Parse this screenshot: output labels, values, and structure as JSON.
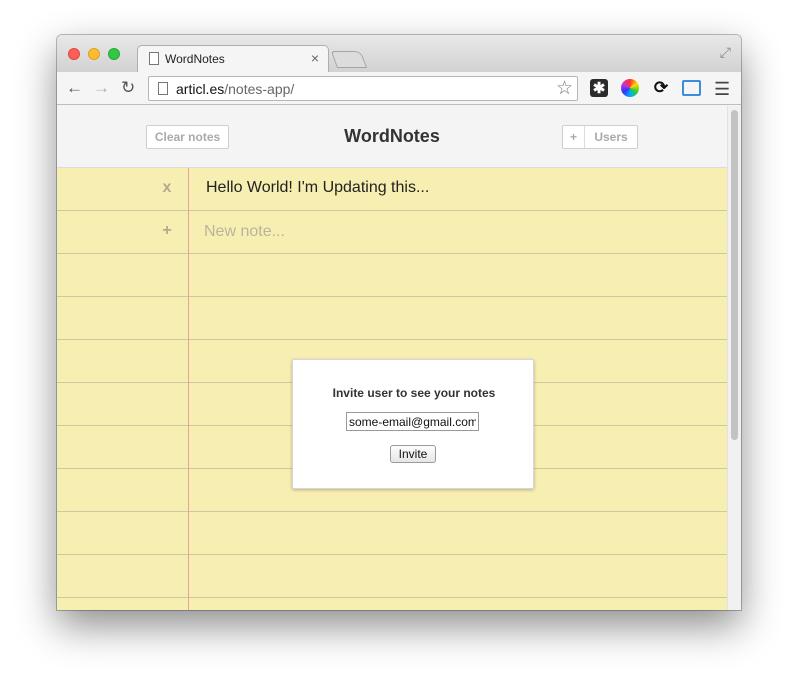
{
  "browser": {
    "tab_title": "WordNotes",
    "tab_close_glyph": "×",
    "url_host": "articl.es",
    "url_path": "/notes-app/",
    "icons": [
      "back-arrow-icon",
      "forward-arrow-icon",
      "reload-icon",
      "page-icon",
      "star-icon",
      "asterisk-extension-icon",
      "color-wheel-extension-icon",
      "sync-extension-icon",
      "screenshot-extension-icon",
      "menu-icon",
      "fullscreen-icon"
    ]
  },
  "header": {
    "clear_label": "Clear notes",
    "title": "WordNotes",
    "users_plus": "+",
    "users_label": "Users"
  },
  "notes": [
    {
      "icon": "x",
      "text": "Hello World! I'm Updating this..."
    }
  ],
  "new_note": {
    "icon": "+",
    "placeholder": "New note..."
  },
  "modal": {
    "title": "Invite user to see your notes",
    "email_value": "some-email@gmail.com",
    "invite_label": "Invite"
  },
  "colors": {
    "paper": "#f7eeb2",
    "ruled_line": "#cdc7a4",
    "margin_line": "#e8a0a0"
  }
}
